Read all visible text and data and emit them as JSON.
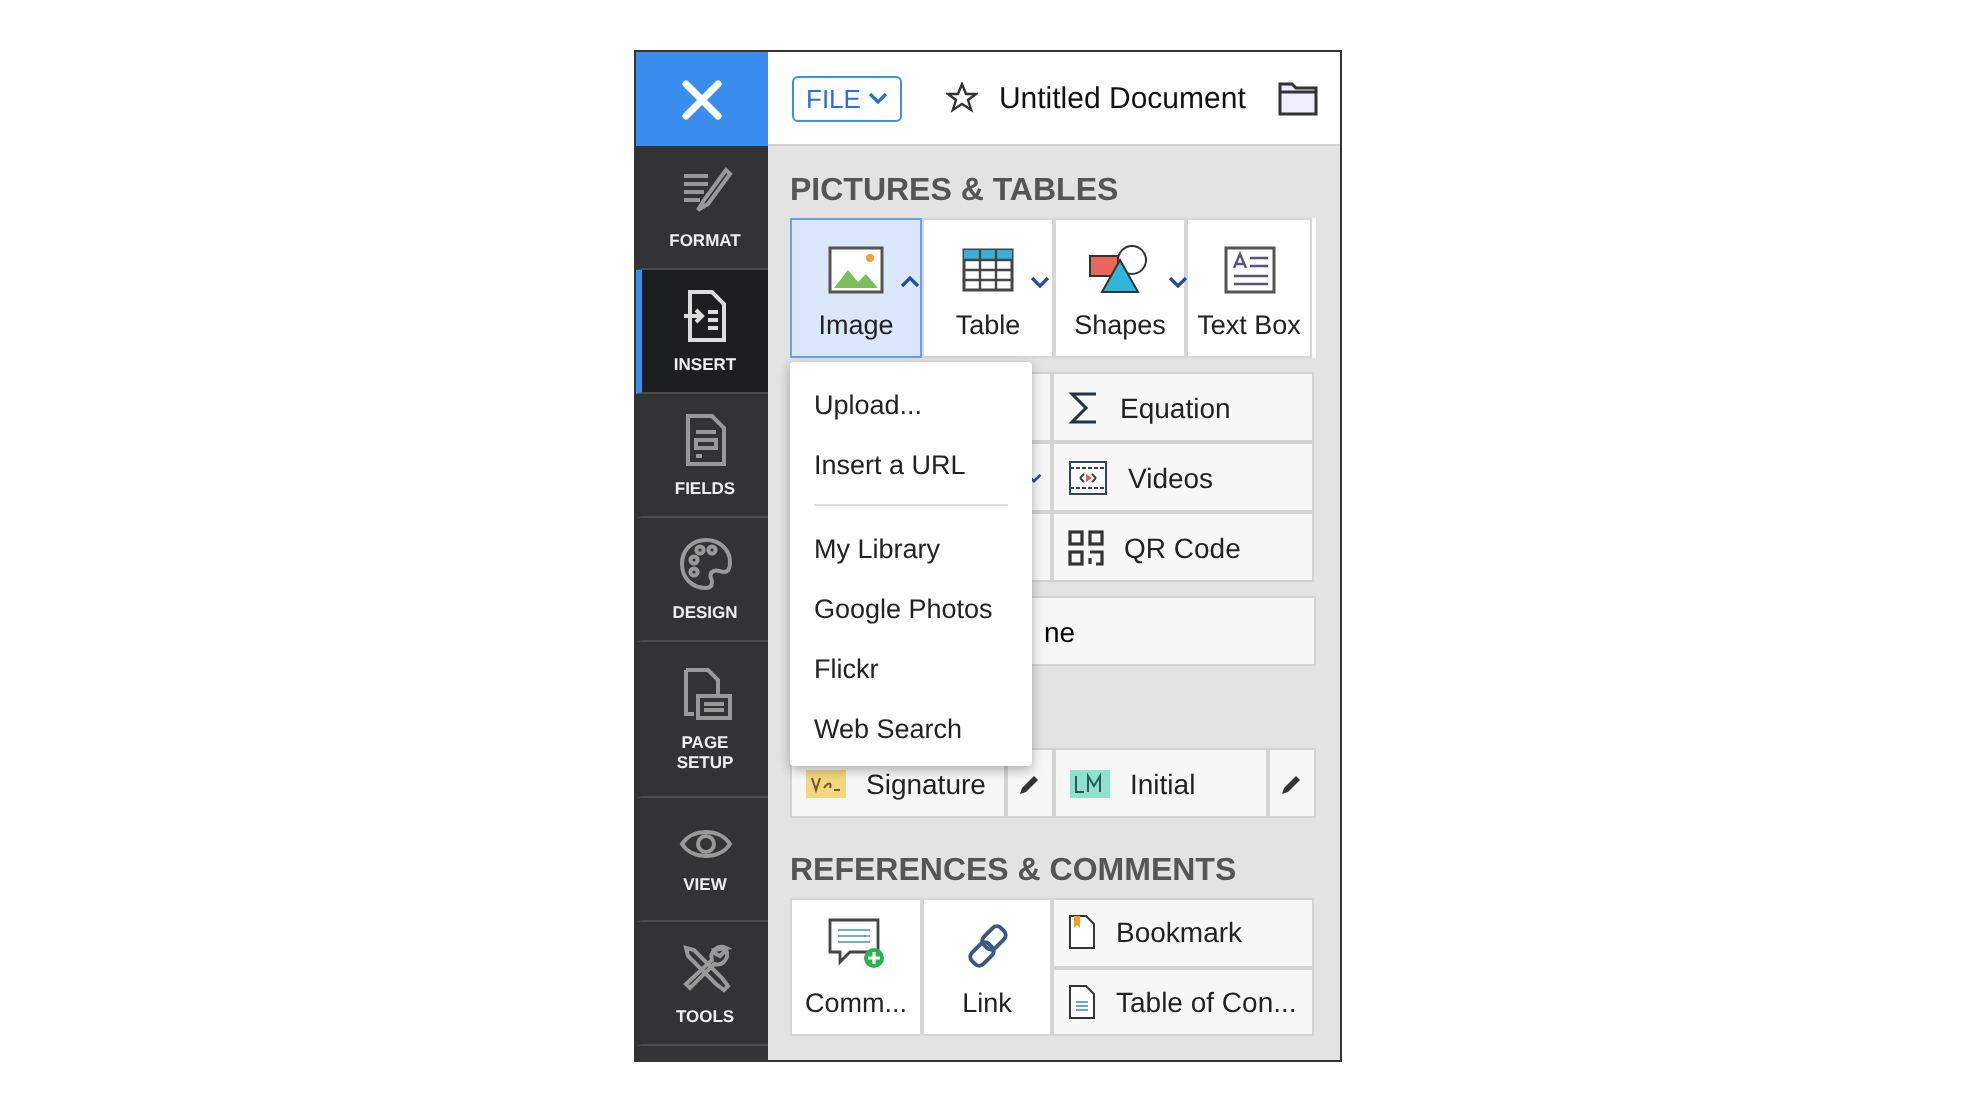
{
  "toolbar": {
    "file_menu": "FILE",
    "document_title": "Untitled Document"
  },
  "sidebar": {
    "items": [
      {
        "kind": "format",
        "label": "FORMAT",
        "selected": false
      },
      {
        "kind": "insert",
        "label": "INSERT",
        "selected": true
      },
      {
        "kind": "fields",
        "label": "FIELDS",
        "selected": false
      },
      {
        "kind": "design",
        "label": "DESIGN",
        "selected": false
      },
      {
        "kind": "page",
        "label": "PAGE SETUP",
        "selected": false
      },
      {
        "kind": "view",
        "label": "VIEW",
        "selected": false
      },
      {
        "kind": "tools",
        "label": "TOOLS",
        "selected": false
      }
    ]
  },
  "insert_panel": {
    "pictures_title": "PICTURES & TABLES",
    "large_tools": [
      {
        "kind": "image",
        "label": "Image",
        "selected": true,
        "has_menu": true,
        "expanded": true
      },
      {
        "kind": "table",
        "label": "Table",
        "selected": false,
        "has_menu": true,
        "expanded": false
      },
      {
        "kind": "shapes",
        "label": "Shapes",
        "selected": false,
        "has_menu": true,
        "expanded": false
      },
      {
        "kind": "textbox",
        "label": "Text Box",
        "selected": false,
        "has_menu": false
      }
    ],
    "small_tools": [
      {
        "kind": "equation",
        "label": "Equation"
      },
      {
        "kind": "videos",
        "label": "Videos"
      },
      {
        "kind": "qr",
        "label": "QR Code"
      }
    ],
    "partial_tool": {
      "label": "ne"
    },
    "sign_tools": [
      {
        "kind": "signature",
        "label": "Signature"
      },
      {
        "kind": "initial",
        "label": "Initial"
      }
    ],
    "references_title": "REFERENCES & COMMENTS",
    "ref_large": [
      {
        "kind": "comment",
        "label": "Comm..."
      },
      {
        "kind": "link",
        "label": "Link"
      }
    ],
    "ref_small": [
      {
        "kind": "bookmark",
        "label": "Bookmark"
      },
      {
        "kind": "toc",
        "label": "Table of Con..."
      }
    ]
  },
  "image_menu": {
    "groups": [
      [
        "Upload...",
        "Insert a URL"
      ],
      [
        "My Library",
        "Google Photos",
        "Flickr",
        "Web Search"
      ]
    ]
  }
}
